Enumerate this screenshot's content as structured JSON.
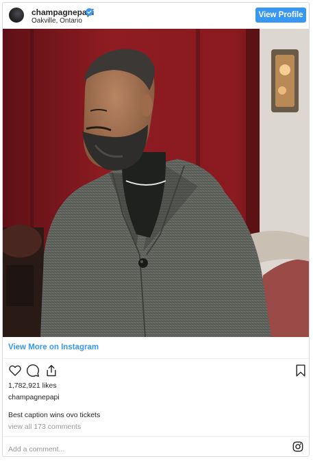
{
  "header": {
    "username": "champagnepapi",
    "location": "Oakville, Ontario",
    "view_profile_label": "View Profile"
  },
  "post": {
    "view_more_label": "View More on Instagram",
    "likes": "1,782,921 likes",
    "owner": "champagnepapi",
    "caption": "Best caption wins ovo tickets",
    "comments_link": "view all 173 comments",
    "comment_placeholder": "Add a comment..."
  },
  "colors": {
    "accent": "#3897f0",
    "text": "#262626",
    "muted": "#999999",
    "border": "#dbdbdb"
  },
  "icons": [
    "verified-badge-icon",
    "heart-icon",
    "comment-icon",
    "share-icon",
    "bookmark-icon",
    "instagram-logo-icon"
  ]
}
